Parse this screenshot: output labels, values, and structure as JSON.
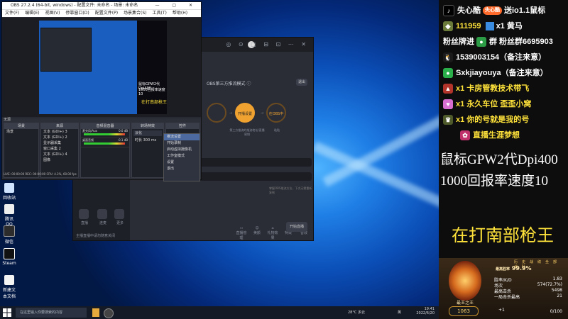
{
  "obs": {
    "window_title": "OBS 27.2.4 (64-bit, windows) - 配置文件: 未命名 - 场景: 未命名",
    "window_controls": "— ▢ ✕",
    "menu": [
      "文件(F)",
      "编辑(E)",
      "视图(V)",
      "停靠窗口(D)",
      "配置文件(P)",
      "场景集合(S)",
      "工具(T)",
      "帮助(H)"
    ],
    "preview_lines": [
      "鼠标GPW2代Dpi400",
      "1000回报率速度10",
      "在打南部枪王"
    ],
    "scenes_header": "场景",
    "sources_header": "来源",
    "mixer_header": "音频混音器",
    "transitions_header": "转场特效",
    "controls_header": "控件",
    "scene_item": "场景",
    "sources": [
      "文本 (GDI+) 3",
      "文本 (GDI+) 2",
      "显示器采集",
      "窗口采集 2",
      "文本 (GDI+) 4",
      "图像"
    ],
    "mixer_tracks": [
      {
        "name": "麦克风/Aux",
        "level": "0.0 dB"
      },
      {
        "name": "桌面音频",
        "level": "-0.1 dB"
      }
    ],
    "transition_value": "淡化",
    "duration_label": "时长",
    "duration_value": "300 ms",
    "controls": [
      "开始推流",
      "开始录制",
      "启动虚拟摄像机",
      "工作室模式",
      "设置",
      "退出"
    ],
    "status": "LIVE: 00:00:00   REC: 00:00:00   CPU: 4.3%, 60.00 fps"
  },
  "context_menu": {
    "items": [
      "推流设置",
      "开始录制",
      "启动虚拟摄像机",
      "工作室模式",
      "设置",
      "退出"
    ],
    "selected_index": 0
  },
  "live_app": {
    "heading": "OBS第三方推流模式",
    "help_icon": "help-icon",
    "exit_button": "退出",
    "steps": [
      {
        "label": "",
        "caption": ""
      },
      {
        "label": "开播设置",
        "caption": "第三方推流的推流地址/直播密钥"
      },
      {
        "label": "在OBS中",
        "caption": "粘贴"
      }
    ],
    "server_copy_button": "复制",
    "key_copy_button": "复制",
    "hint": "掌握OBS推流方法，下次无需重新复制",
    "sidebar": [
      "直播",
      "直播",
      "连麦",
      "更多"
    ],
    "tools": [
      "直播管理",
      "美颜",
      "礼物效果",
      "特效",
      "音效",
      "声音"
    ],
    "start_button": "开始直播",
    "footer": "主播直播中请勿随意关闭"
  },
  "desktop_icons": [
    "回收站",
    "腾讯QQ",
    "微信",
    "Steam",
    "抖音直播伴侣",
    "新建文本文档"
  ],
  "taskbar": {
    "search_placeholder": "在这里输入你要搜索的内容",
    "weather": "28°C 多云",
    "time": "19:41",
    "date": "2022/6/20",
    "ime": "英"
  },
  "overlay": {
    "rows": [
      {
        "icon": "tiktok-icon",
        "text": "失心酷",
        "badge": "失心酷",
        "suffix": "送io1.1鼠标"
      },
      {
        "icon": "fan-icon",
        "text": "111959",
        "suffix": "x1 黄马"
      },
      {
        "icon": "",
        "text": "粉丝牌进",
        "suffix": "群 粉丝群6695903"
      },
      {
        "icon": "qq-icon",
        "text": "1539003154（备注来意）"
      },
      {
        "icon": "wechat-icon",
        "text": "Sxkjiayouya（备注来意）"
      },
      {
        "icon": "rocket-icon",
        "text": "x1 卡房管教技术带飞"
      },
      {
        "icon": "heart-icon",
        "text": "x1 永久车位 歪歪小窝"
      },
      {
        "icon": "crown-icon",
        "text": "x1 你的号就是我的号"
      },
      {
        "icon": "gift-icon",
        "text": "直播生涯梦想"
      }
    ],
    "big_line_1": "鼠标GPW2代Dpi400",
    "big_line_2": "1000回报率速度10",
    "king_text": "在打南部枪王",
    "rank": {
      "badge_label": "最王之王",
      "tabs": [
        "历史战绩",
        "全部",
        "战队"
      ],
      "win_label": "最高胜率",
      "win_pct": "99.9%",
      "stats": [
        {
          "label": "胜率/K/D",
          "value": "1.83"
        },
        {
          "label": "场次",
          "value": "574(72.7%)"
        },
        {
          "label": "最高击杀",
          "value": "5498"
        },
        {
          "label": "一局击杀最高",
          "value": "21"
        }
      ],
      "score": "1063",
      "plus": "+1",
      "counter": "0/100"
    }
  },
  "colors": {
    "accent_orange": "#f0a230",
    "overlay_yellow": "#ffe23a",
    "obs_dark": "#272a33"
  }
}
